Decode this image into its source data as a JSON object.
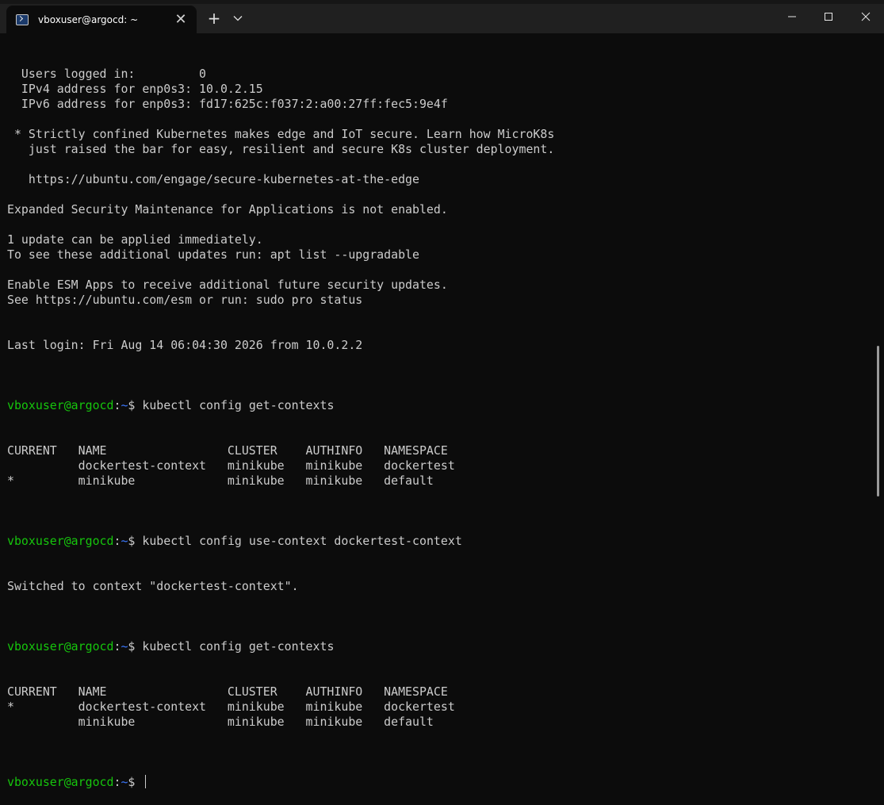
{
  "window": {
    "tab_title": "vboxuser@argocd: ~",
    "tab_close_glyph": "✕",
    "new_tab_glyph": "+",
    "tab_icon": "terminal-icon"
  },
  "terminal": {
    "motd": [
      "  Users logged in:         0",
      "  IPv4 address for enp0s3: 10.0.2.15",
      "  IPv6 address for enp0s3: fd17:625c:f037:2:a00:27ff:fec5:9e4f",
      "",
      " * Strictly confined Kubernetes makes edge and IoT secure. Learn how MicroK8s",
      "   just raised the bar for easy, resilient and secure K8s cluster deployment.",
      "",
      "   https://ubuntu.com/engage/secure-kubernetes-at-the-edge",
      "",
      "Expanded Security Maintenance for Applications is not enabled.",
      "",
      "1 update can be applied immediately.",
      "To see these additional updates run: apt list --upgradable",
      "",
      "Enable ESM Apps to receive additional future security updates.",
      "See https://ubuntu.com/esm or run: sudo pro status",
      "",
      "",
      "Last login: Fri Aug 14 06:04:30 2026 from 10.0.2.2"
    ],
    "prompt": {
      "user": "vboxuser@argocd",
      "sep": ":",
      "path": "~",
      "symbol": "$ "
    },
    "cmd1": "kubectl config get-contexts",
    "out1": [
      "CURRENT   NAME                 CLUSTER    AUTHINFO   NAMESPACE",
      "          dockertest-context   minikube   minikube   dockertest",
      "*         minikube             minikube   minikube   default"
    ],
    "cmd2": "kubectl config use-context dockertest-context",
    "out2": [
      "Switched to context \"dockertest-context\"."
    ],
    "cmd3": "kubectl config get-contexts",
    "out3": [
      "CURRENT   NAME                 CLUSTER    AUTHINFO   NAMESPACE",
      "*         dockertest-context   minikube   minikube   dockertest",
      "          minikube             minikube   minikube   default"
    ]
  },
  "colors": {
    "background": "#0c0c0c",
    "titlebar": "#202020",
    "prompt_user": "#16c60c",
    "prompt_path": "#3b78ff",
    "text": "#cccccc"
  }
}
